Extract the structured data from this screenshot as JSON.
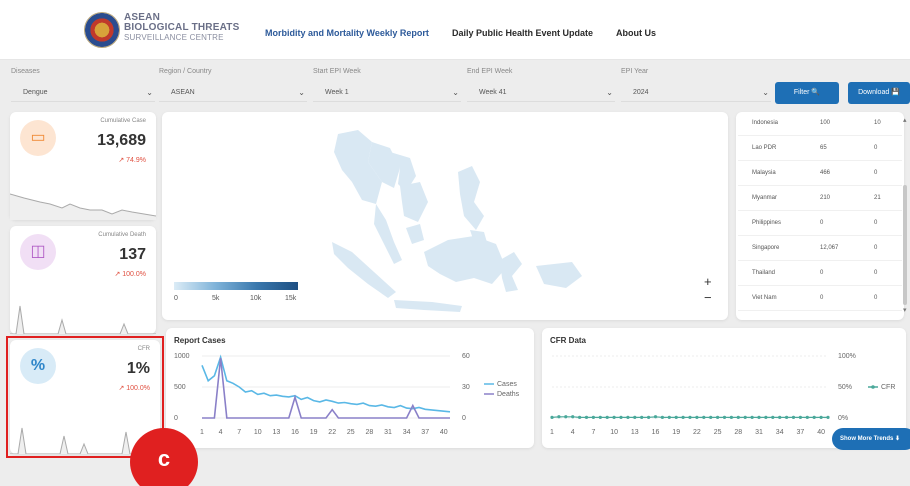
{
  "header": {
    "brand": {
      "line1": "ASEAN",
      "line2": "BIOLOGICAL THREATS",
      "line3": "SURVEILLANCE CENTRE"
    },
    "nav": [
      {
        "label": "Morbidity and Mortality Weekly Report",
        "active": true
      },
      {
        "label": "Daily Public Health Event Update",
        "active": false
      },
      {
        "label": "About Us",
        "active": false
      }
    ]
  },
  "filters": [
    {
      "label": "Diseases",
      "value": "Dengue"
    },
    {
      "label": "Region / Country",
      "value": "ASEAN"
    },
    {
      "label": "Start EPI Week",
      "value": "Week 1"
    },
    {
      "label": "End EPI Week",
      "value": "Week 41"
    },
    {
      "label": "EPI Year",
      "value": "2024"
    }
  ],
  "buttons": {
    "filter": "Filter 🔍",
    "download": "Download 💾"
  },
  "kpis": [
    {
      "label": "Cumulative Case",
      "value": "13,689",
      "change": "↗ 74.9%",
      "icon": "chat-icon",
      "color": "#f08a36"
    },
    {
      "label": "Cumulative Death",
      "value": "137",
      "change": "↗ 100.0%",
      "icon": "briefcase-icon",
      "color": "#b15cc6"
    },
    {
      "label": "CFR",
      "value": "1%",
      "change": "↗ 100.0%",
      "icon": "percent-icon",
      "color": "#2f86c9"
    }
  ],
  "map": {
    "legend_ticks": [
      "0",
      "5k",
      "10k",
      "15k"
    ],
    "zoom_in": "+",
    "zoom_out": "−"
  },
  "country_table": [
    {
      "country": "Indonesia",
      "cases": "100",
      "deaths": "10"
    },
    {
      "country": "Lao PDR",
      "cases": "65",
      "deaths": "0"
    },
    {
      "country": "Malaysia",
      "cases": "466",
      "deaths": "0"
    },
    {
      "country": "Myanmar",
      "cases": "210",
      "deaths": "21"
    },
    {
      "country": "Philippines",
      "cases": "0",
      "deaths": "0"
    },
    {
      "country": "Singapore",
      "cases": "12,067",
      "deaths": "0"
    },
    {
      "country": "Thailand",
      "cases": "0",
      "deaths": "0"
    },
    {
      "country": "Viet Nam",
      "cases": "0",
      "deaths": "0"
    }
  ],
  "annotation": {
    "marker": "c"
  },
  "more_button": "Show More Trends ⬇",
  "chart_data": [
    {
      "type": "line",
      "title": "Report Cases",
      "x": [
        1,
        2,
        3,
        4,
        5,
        6,
        7,
        8,
        9,
        10,
        11,
        12,
        13,
        14,
        15,
        16,
        17,
        18,
        19,
        20,
        21,
        22,
        23,
        24,
        25,
        26,
        27,
        28,
        29,
        30,
        31,
        32,
        33,
        34,
        35,
        36,
        37,
        38,
        39,
        40,
        41
      ],
      "xticks": [
        1,
        4,
        7,
        10,
        13,
        16,
        19,
        22,
        25,
        28,
        31,
        34,
        37,
        40
      ],
      "y_left_ticks": [
        0,
        500,
        1000
      ],
      "y_right_ticks": [
        0,
        30,
        60
      ],
      "ylim_left": [
        0,
        1000
      ],
      "ylim_right": [
        0,
        60
      ],
      "legend_placement": "right",
      "series": [
        {
          "name": "Cases",
          "axis": "left",
          "color": "#5ab8e6",
          "values": [
            850,
            600,
            680,
            980,
            600,
            560,
            500,
            420,
            440,
            380,
            400,
            360,
            370,
            350,
            340,
            360,
            300,
            330,
            280,
            260,
            290,
            270,
            240,
            250,
            230,
            220,
            240,
            200,
            190,
            210,
            180,
            170,
            200,
            160,
            150,
            170,
            140,
            130,
            120,
            110,
            100
          ]
        },
        {
          "name": "Deaths",
          "axis": "right",
          "color": "#8a80c8",
          "values": [
            0,
            0,
            0,
            58,
            0,
            0,
            0,
            0,
            0,
            0,
            0,
            0,
            0,
            0,
            0,
            20,
            0,
            0,
            0,
            0,
            0,
            8,
            0,
            0,
            0,
            0,
            0,
            0,
            0,
            0,
            0,
            0,
            0,
            0,
            12,
            0,
            0,
            0,
            0,
            0,
            0
          ]
        }
      ]
    },
    {
      "type": "line",
      "title": "CFR Data",
      "x": [
        1,
        2,
        3,
        4,
        5,
        6,
        7,
        8,
        9,
        10,
        11,
        12,
        13,
        14,
        15,
        16,
        17,
        18,
        19,
        20,
        21,
        22,
        23,
        24,
        25,
        26,
        27,
        28,
        29,
        30,
        31,
        32,
        33,
        34,
        35,
        36,
        37,
        38,
        39,
        40,
        41
      ],
      "xticks": [
        1,
        4,
        7,
        10,
        13,
        16,
        19,
        22,
        25,
        28,
        31,
        34,
        37,
        40
      ],
      "y_right_ticks": [
        "0%",
        "50%",
        "100%"
      ],
      "ylim": [
        0,
        100
      ],
      "legend_placement": "right",
      "series": [
        {
          "name": "CFR",
          "color": "#4aa89a",
          "values": [
            1,
            2,
            2,
            2,
            1,
            1,
            1,
            1,
            1,
            1,
            1,
            1,
            1,
            1,
            1,
            2,
            1,
            1,
            1,
            1,
            1,
            1,
            1,
            1,
            1,
            1,
            1,
            1,
            1,
            1,
            1,
            1,
            1,
            1,
            1,
            1,
            1,
            1,
            1,
            1,
            1
          ]
        }
      ]
    }
  ]
}
